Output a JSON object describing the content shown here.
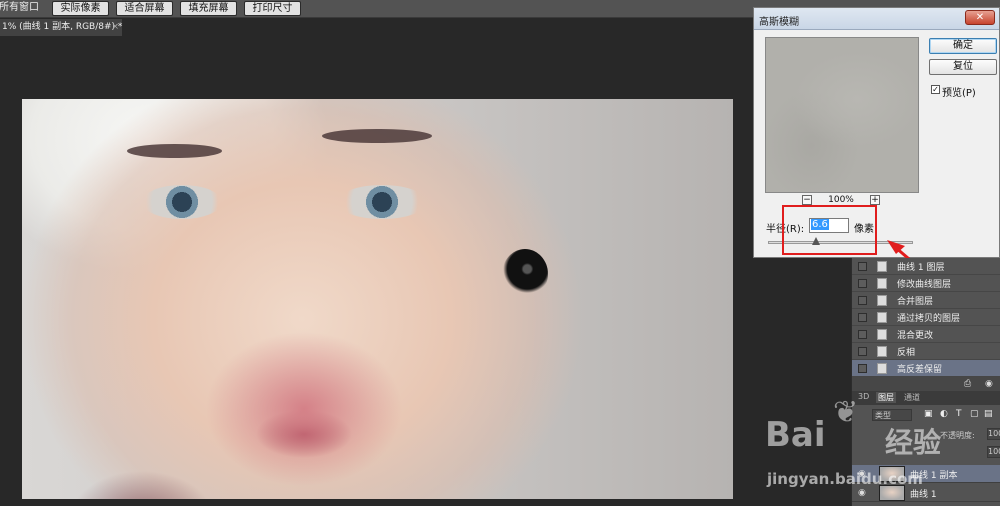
{
  "toolbar": {
    "fit_all_windows": "所有窗口",
    "actual_pixels": "实际像素",
    "fit_screen": "适合屏幕",
    "fill_screen": "填充屏幕",
    "print_size": "打印尺寸"
  },
  "document_tab": {
    "label": "1% (曲线 1 副本, RGB/8#) *",
    "close": "×"
  },
  "dialog": {
    "title": "高斯模糊",
    "close": "✕",
    "ok": "确定",
    "reset": "复位",
    "preview_checked": true,
    "preview_check_mark": "✓",
    "preview_label": "预览(P)",
    "zoom_out": "−",
    "zoom_in": "+",
    "zoom_level": "100%",
    "radius_label": "半径(R):",
    "radius_value": "6.6",
    "radius_unit": "像素",
    "slider_fraction": 0.33
  },
  "history": {
    "items": [
      {
        "label": "曲线 1 图层",
        "selected": false
      },
      {
        "label": "修改曲线图层",
        "selected": false
      },
      {
        "label": "合并图层",
        "selected": false
      },
      {
        "label": "通过拷贝的图层",
        "selected": false
      },
      {
        "label": "混合更改",
        "selected": false
      },
      {
        "label": "反相",
        "selected": false
      },
      {
        "label": "高反差保留",
        "selected": true
      }
    ]
  },
  "layers_panel": {
    "tabs": [
      "3D",
      "图层",
      "通道"
    ],
    "active_tab": 1,
    "filter_label": "类型",
    "opacity_label": "不透明度:",
    "opacity_value": "100",
    "fill_value": "100",
    "layers": [
      {
        "name": "曲线 1 副本",
        "selected": true
      },
      {
        "name": "曲线 1",
        "selected": false
      }
    ]
  },
  "watermark": {
    "brand": "Bai",
    "brand_cn": "经验",
    "url": "jingyan.baidu.com"
  },
  "colors": {
    "highlight": "#e01d1d",
    "selection": "#3399ff"
  }
}
